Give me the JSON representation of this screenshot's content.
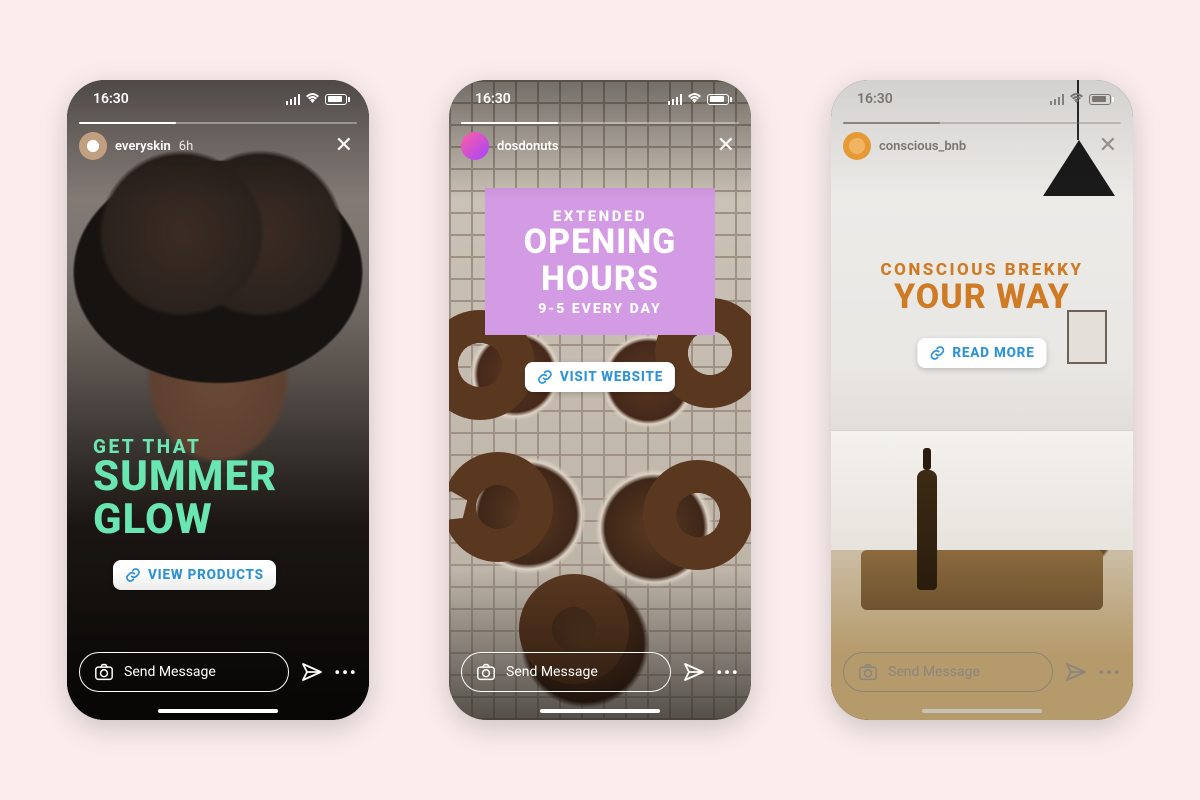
{
  "status": {
    "time": "16:30"
  },
  "common": {
    "send_message": "Send Message",
    "more": "•••"
  },
  "phones": [
    {
      "username": "everyskin",
      "time_ago": "6h",
      "headline": {
        "l1": "GET THAT",
        "l2": "SUMMER",
        "l3": "GLOW"
      },
      "cta": "VIEW PRODUCTS"
    },
    {
      "username": "dosdonuts",
      "time_ago": "",
      "banner": {
        "b1": "EXTENDED",
        "b2": "OPENING",
        "b3": "HOURS",
        "b4": "9-5 EVERY DAY"
      },
      "cta": "VISIT WEBSITE"
    },
    {
      "username": "conscious_bnb",
      "time_ago": "",
      "headline": {
        "l1": "CONSCIOUS BREKKY",
        "l2": "YOUR WAY"
      },
      "cta": "READ MORE"
    }
  ]
}
